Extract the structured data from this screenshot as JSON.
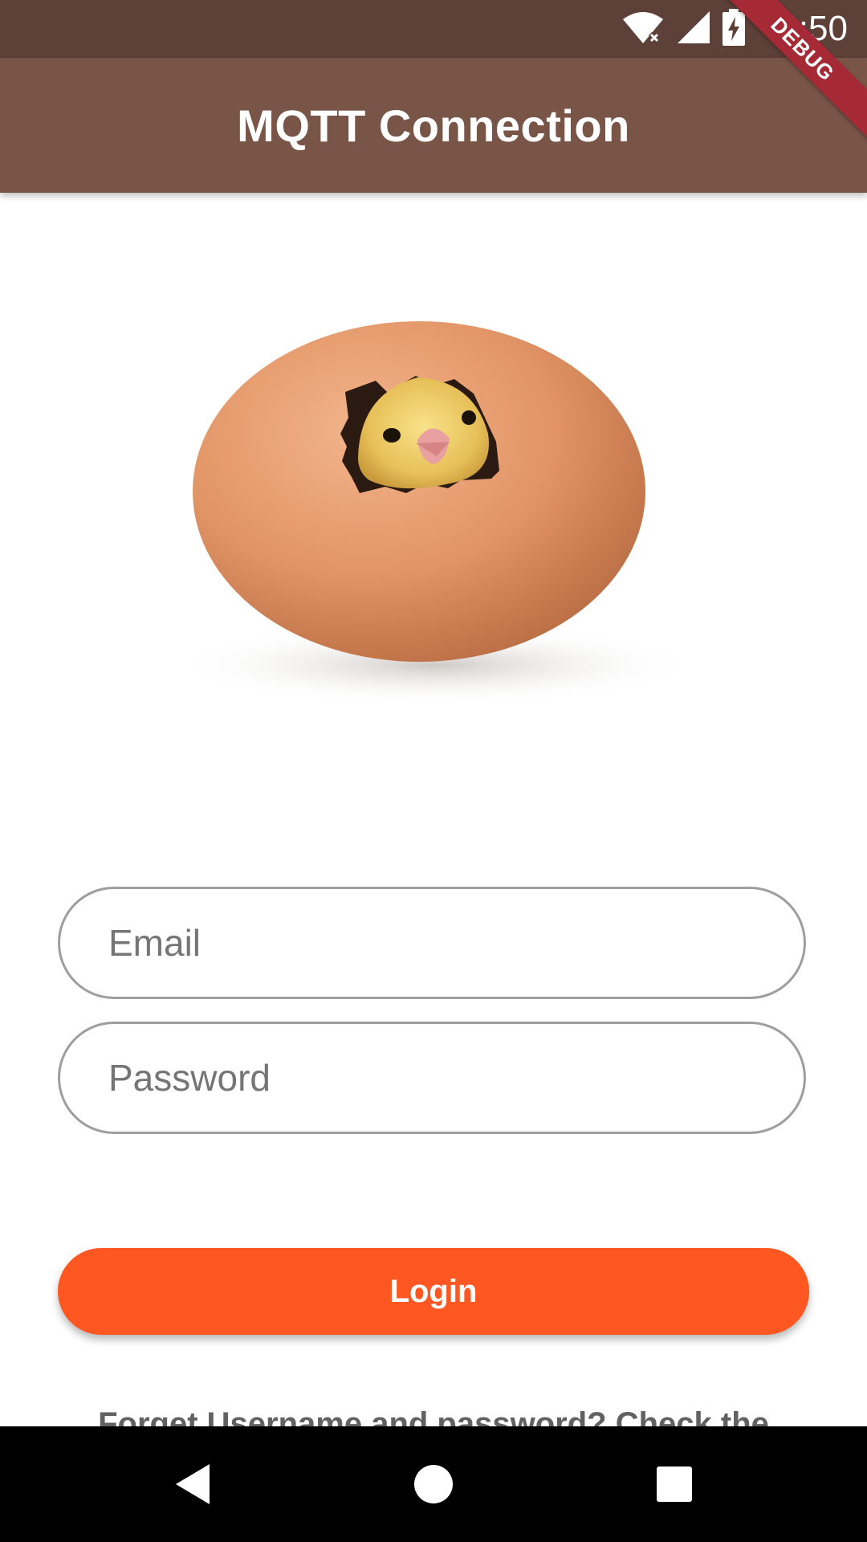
{
  "status_bar": {
    "time": "4:50",
    "icons": [
      "wifi-icon",
      "signal-icon",
      "battery-charging-icon"
    ]
  },
  "debug_banner": {
    "label": "DEBUG"
  },
  "app_bar": {
    "title": "MQTT Connection"
  },
  "hero_image": {
    "subject": "chick-hatching-from-egg"
  },
  "form": {
    "email": {
      "placeholder": "Email",
      "value": ""
    },
    "password": {
      "placeholder": "Password",
      "value": ""
    },
    "login_label": "Login"
  },
  "forgot_text": "Forget Username and password? Check the",
  "nav_bar": {
    "icons": [
      "back-icon",
      "home-icon",
      "recents-icon"
    ]
  },
  "colors": {
    "status_bar": "#5d4037",
    "app_bar": "#795548",
    "accent": "#ff5722",
    "field_border": "#9e9e9e",
    "debug_banner": "#a52a36"
  }
}
